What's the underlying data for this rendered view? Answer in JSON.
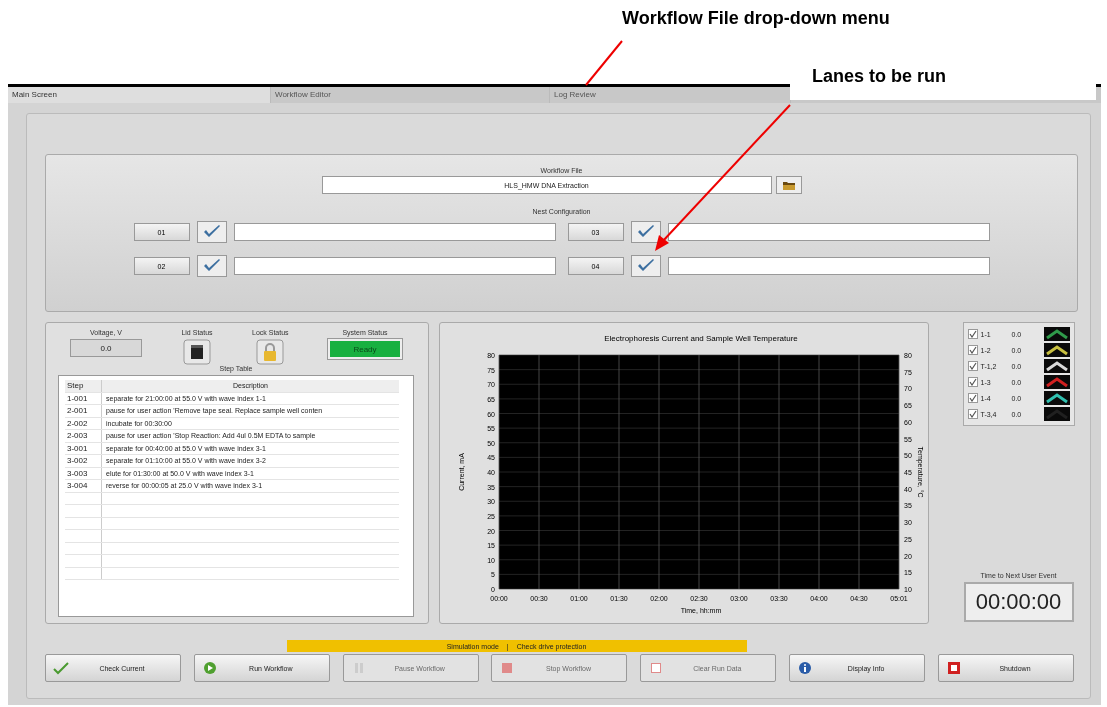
{
  "annotations": [
    {
      "text": "Workflow File drop-down menu",
      "kind": "line"
    },
    {
      "text": "Lanes to be run",
      "kind": "arrow"
    }
  ],
  "tabs": [
    {
      "label": "Main Screen",
      "selected": true
    },
    {
      "label": "Workflow Editor",
      "selected": false
    },
    {
      "label": "Log Review",
      "selected": false
    }
  ],
  "workflow_file": {
    "label": "Workflow File",
    "value": "HLS_HMW DNA Extraction"
  },
  "nest_configuration": {
    "label": "Nest Configuration",
    "lanes": [
      {
        "button": "01",
        "checked": true
      },
      {
        "button": "03",
        "checked": true
      },
      {
        "button": "02",
        "checked": true
      },
      {
        "button": "04",
        "checked": true
      }
    ]
  },
  "status": {
    "voltage_label": "Voltage, V",
    "voltage": "0.0",
    "lid_label": "Lid Status",
    "lock_label": "Lock Status",
    "system_label": "System Status",
    "system": "Ready"
  },
  "step_table": {
    "title": "Step Table",
    "columns": [
      "Step",
      "Description"
    ],
    "rows": [
      [
        "1-001",
        "separate for 21:00:00 at 55.0 V with wave index 1-1"
      ],
      [
        "2-001",
        "pause for user action 'Remove tape seal. Replace sample well conten"
      ],
      [
        "2-002",
        "incubate for 00:30:00"
      ],
      [
        "2-003",
        "pause for user action 'Stop Reaction: Add 4ul 0.5M EDTA to sample"
      ],
      [
        "3-001",
        "separate for 00:40:00 at 55.0 V with wave index 3-1"
      ],
      [
        "3-002",
        "separate for 01:10:00 at 55.0 V with wave index 3-2"
      ],
      [
        "3-003",
        "elute for 01:30:00 at 50.0 V with wave index 3-1"
      ],
      [
        "3-004",
        "reverse for 00:00:05 at 25.0 V with wave index 3-1"
      ]
    ]
  },
  "chart": {
    "chart_data": {
      "type": "line",
      "title": "Electrophoresis Current and Sample Well Temperature",
      "xlabel": "Time, hh:mm",
      "ylabel": "Current, mA",
      "categories": [
        "00:00",
        "00:30",
        "01:00",
        "01:30",
        "02:00",
        "02:30",
        "03:00",
        "03:30",
        "04:00",
        "04:30",
        "05:01"
      ],
      "ylim": [
        0,
        80
      ],
      "yticks": [
        0,
        5,
        10,
        15,
        20,
        25,
        30,
        35,
        40,
        45,
        50,
        55,
        60,
        65,
        70,
        75,
        80
      ],
      "grid": true
    },
    "right_axis": {
      "label": "Temperature, °C",
      "ticks": [
        "80",
        "75",
        "70",
        "65",
        "60",
        "55",
        "50",
        "45",
        "40",
        "35",
        "30",
        "25",
        "20",
        "15",
        "10"
      ]
    }
  },
  "legend": [
    {
      "name": "1-1",
      "value": "0.0",
      "checked": true,
      "color": "#2f9a4a"
    },
    {
      "name": "1-2",
      "value": "0.0",
      "checked": true,
      "color": "#c8c040"
    },
    {
      "name": "T-1,2",
      "value": "0.0",
      "checked": true,
      "color": "#d8d8d8"
    },
    {
      "name": "1-3",
      "value": "0.0",
      "checked": true,
      "color": "#d02020"
    },
    {
      "name": "1-4",
      "value": "0.0",
      "checked": true,
      "color": "#30c0b0"
    },
    {
      "name": "T-3,4",
      "value": "0.0",
      "checked": true,
      "color": "#202020"
    }
  ],
  "timer": {
    "label": "Time to Next User Event",
    "value": "00:00:00"
  },
  "banner": {
    "mode": "Simulation mode",
    "separator": "|",
    "message": "Check drive protection"
  },
  "buttons": [
    {
      "label": "Check Current",
      "kind": "check",
      "disabled": false
    },
    {
      "label": "Run Workflow",
      "kind": "run",
      "disabled": false
    },
    {
      "label": "Pause Workflow",
      "kind": "pause",
      "disabled": true
    },
    {
      "label": "Stop Workflow",
      "kind": "stop",
      "disabled": true
    },
    {
      "label": "Clear Run Data",
      "kind": "clear",
      "disabled": true
    },
    {
      "label": "Display Info",
      "kind": "info",
      "disabled": false
    },
    {
      "label": "Shutdown",
      "kind": "shutdown",
      "disabled": false
    }
  ]
}
